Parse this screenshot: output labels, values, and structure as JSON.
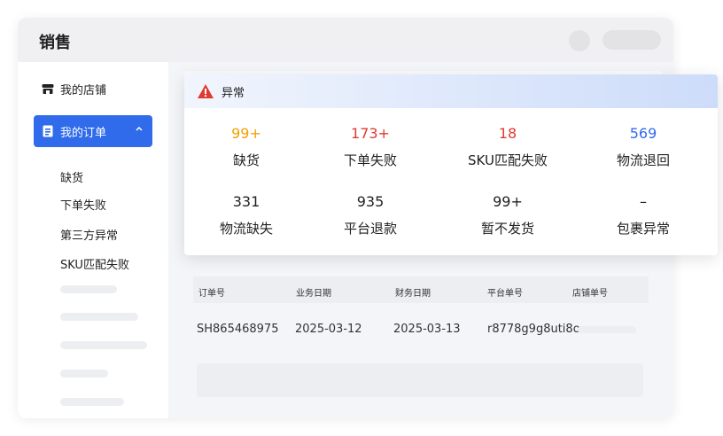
{
  "app": {
    "title": "销售"
  },
  "sidebar": {
    "items": [
      {
        "label": "我的店铺"
      },
      {
        "label": "我的订单",
        "expanded": true
      }
    ],
    "sub_items": [
      "缺货",
      "下单失败",
      "第三方异常",
      "SKU匹配失败"
    ]
  },
  "alert": {
    "title": "异常",
    "stats": [
      {
        "value": "99+",
        "label": "缺货",
        "color": "#f5a000"
      },
      {
        "value": "173+",
        "label": "下单失败",
        "color": "#e03a31"
      },
      {
        "value": "18",
        "label": "SKU匹配失败",
        "color": "#e03a31"
      },
      {
        "value": "569",
        "label": "物流退回",
        "color": "#2f6bea"
      },
      {
        "value": "331",
        "label": "物流缺失",
        "color": "#222222"
      },
      {
        "value": "935",
        "label": "平台退款",
        "color": "#222222"
      },
      {
        "value": "99+",
        "label": "暂不发货",
        "color": "#222222"
      },
      {
        "value": "–",
        "label": "包裹异常",
        "color": "#222222"
      }
    ]
  },
  "table": {
    "columns": [
      "订单号",
      "业务日期",
      "财务日期",
      "平台单号",
      "店铺单号"
    ],
    "rows": [
      [
        "SH865468975",
        "2025-03-12",
        "2025-03-13",
        "r8778g9g8uti8o",
        ""
      ]
    ]
  },
  "colors": {
    "accent": "#2f6bea",
    "warning": "#e03a31",
    "orange": "#f5a000"
  }
}
